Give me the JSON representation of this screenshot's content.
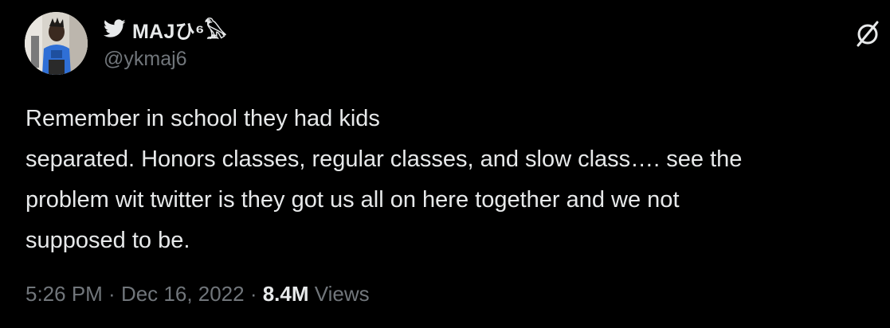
{
  "author": {
    "display_name": "MAJひ⁶𓅃",
    "handle": "@ykmaj6"
  },
  "tweet": {
    "lines": [
      "Remember in school they had kids",
      "separated. Honors classes, regular classes, and slow class…. see the",
      "problem wit twitter is they got us all on here together and we not",
      "supposed to be."
    ]
  },
  "meta": {
    "time": "5:26 PM",
    "separator": " · ",
    "date": "Dec 16, 2022",
    "views_count": "8.4M",
    "views_label": "Views"
  },
  "icons": {
    "bird": "twitter-bird-icon",
    "logo": "x-logo-icon"
  },
  "colors": {
    "background": "#000000",
    "primary_text": "#e7e9ea",
    "secondary_text": "#71767b",
    "avatar_shirt": "#2f6fd6"
  }
}
